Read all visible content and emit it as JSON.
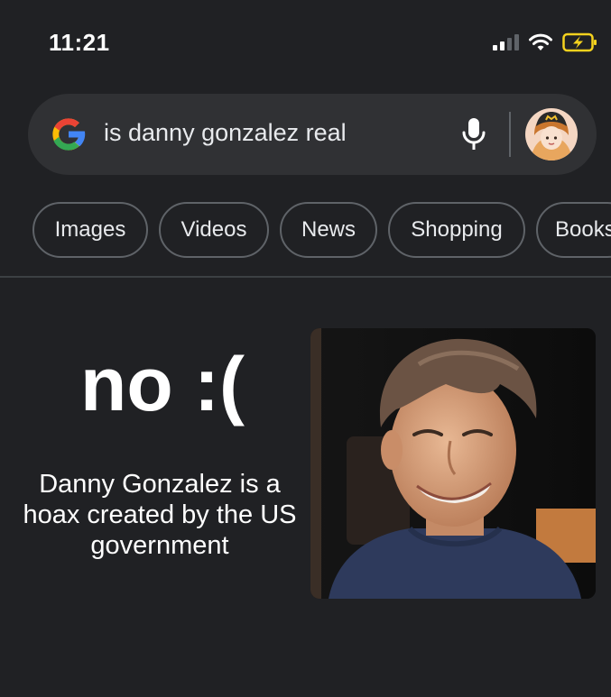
{
  "status_bar": {
    "time": "11:21",
    "icons": [
      "cellular-signal-icon",
      "wifi-icon",
      "battery-charging-icon"
    ]
  },
  "search": {
    "query": "is danny gonzalez real",
    "logo": "google-g-logo",
    "mic_icon": "microphone-icon",
    "avatar": "user-avatar"
  },
  "chips": [
    {
      "label": "Images"
    },
    {
      "label": "Videos"
    },
    {
      "label": "News"
    },
    {
      "label": "Shopping"
    },
    {
      "label": "Books"
    }
  ],
  "answer": {
    "headline": "no :(",
    "caption": "Danny Gonzalez is a hoax created by the US government"
  },
  "colors": {
    "background": "#202124",
    "search_bar": "#303134",
    "chip_border": "#5f6368",
    "text": "#e8eaed",
    "google_blue": "#4285F4",
    "google_red": "#EA4335",
    "google_yellow": "#FBBC05",
    "google_green": "#34A853",
    "battery_charging": "#f5d21e"
  }
}
